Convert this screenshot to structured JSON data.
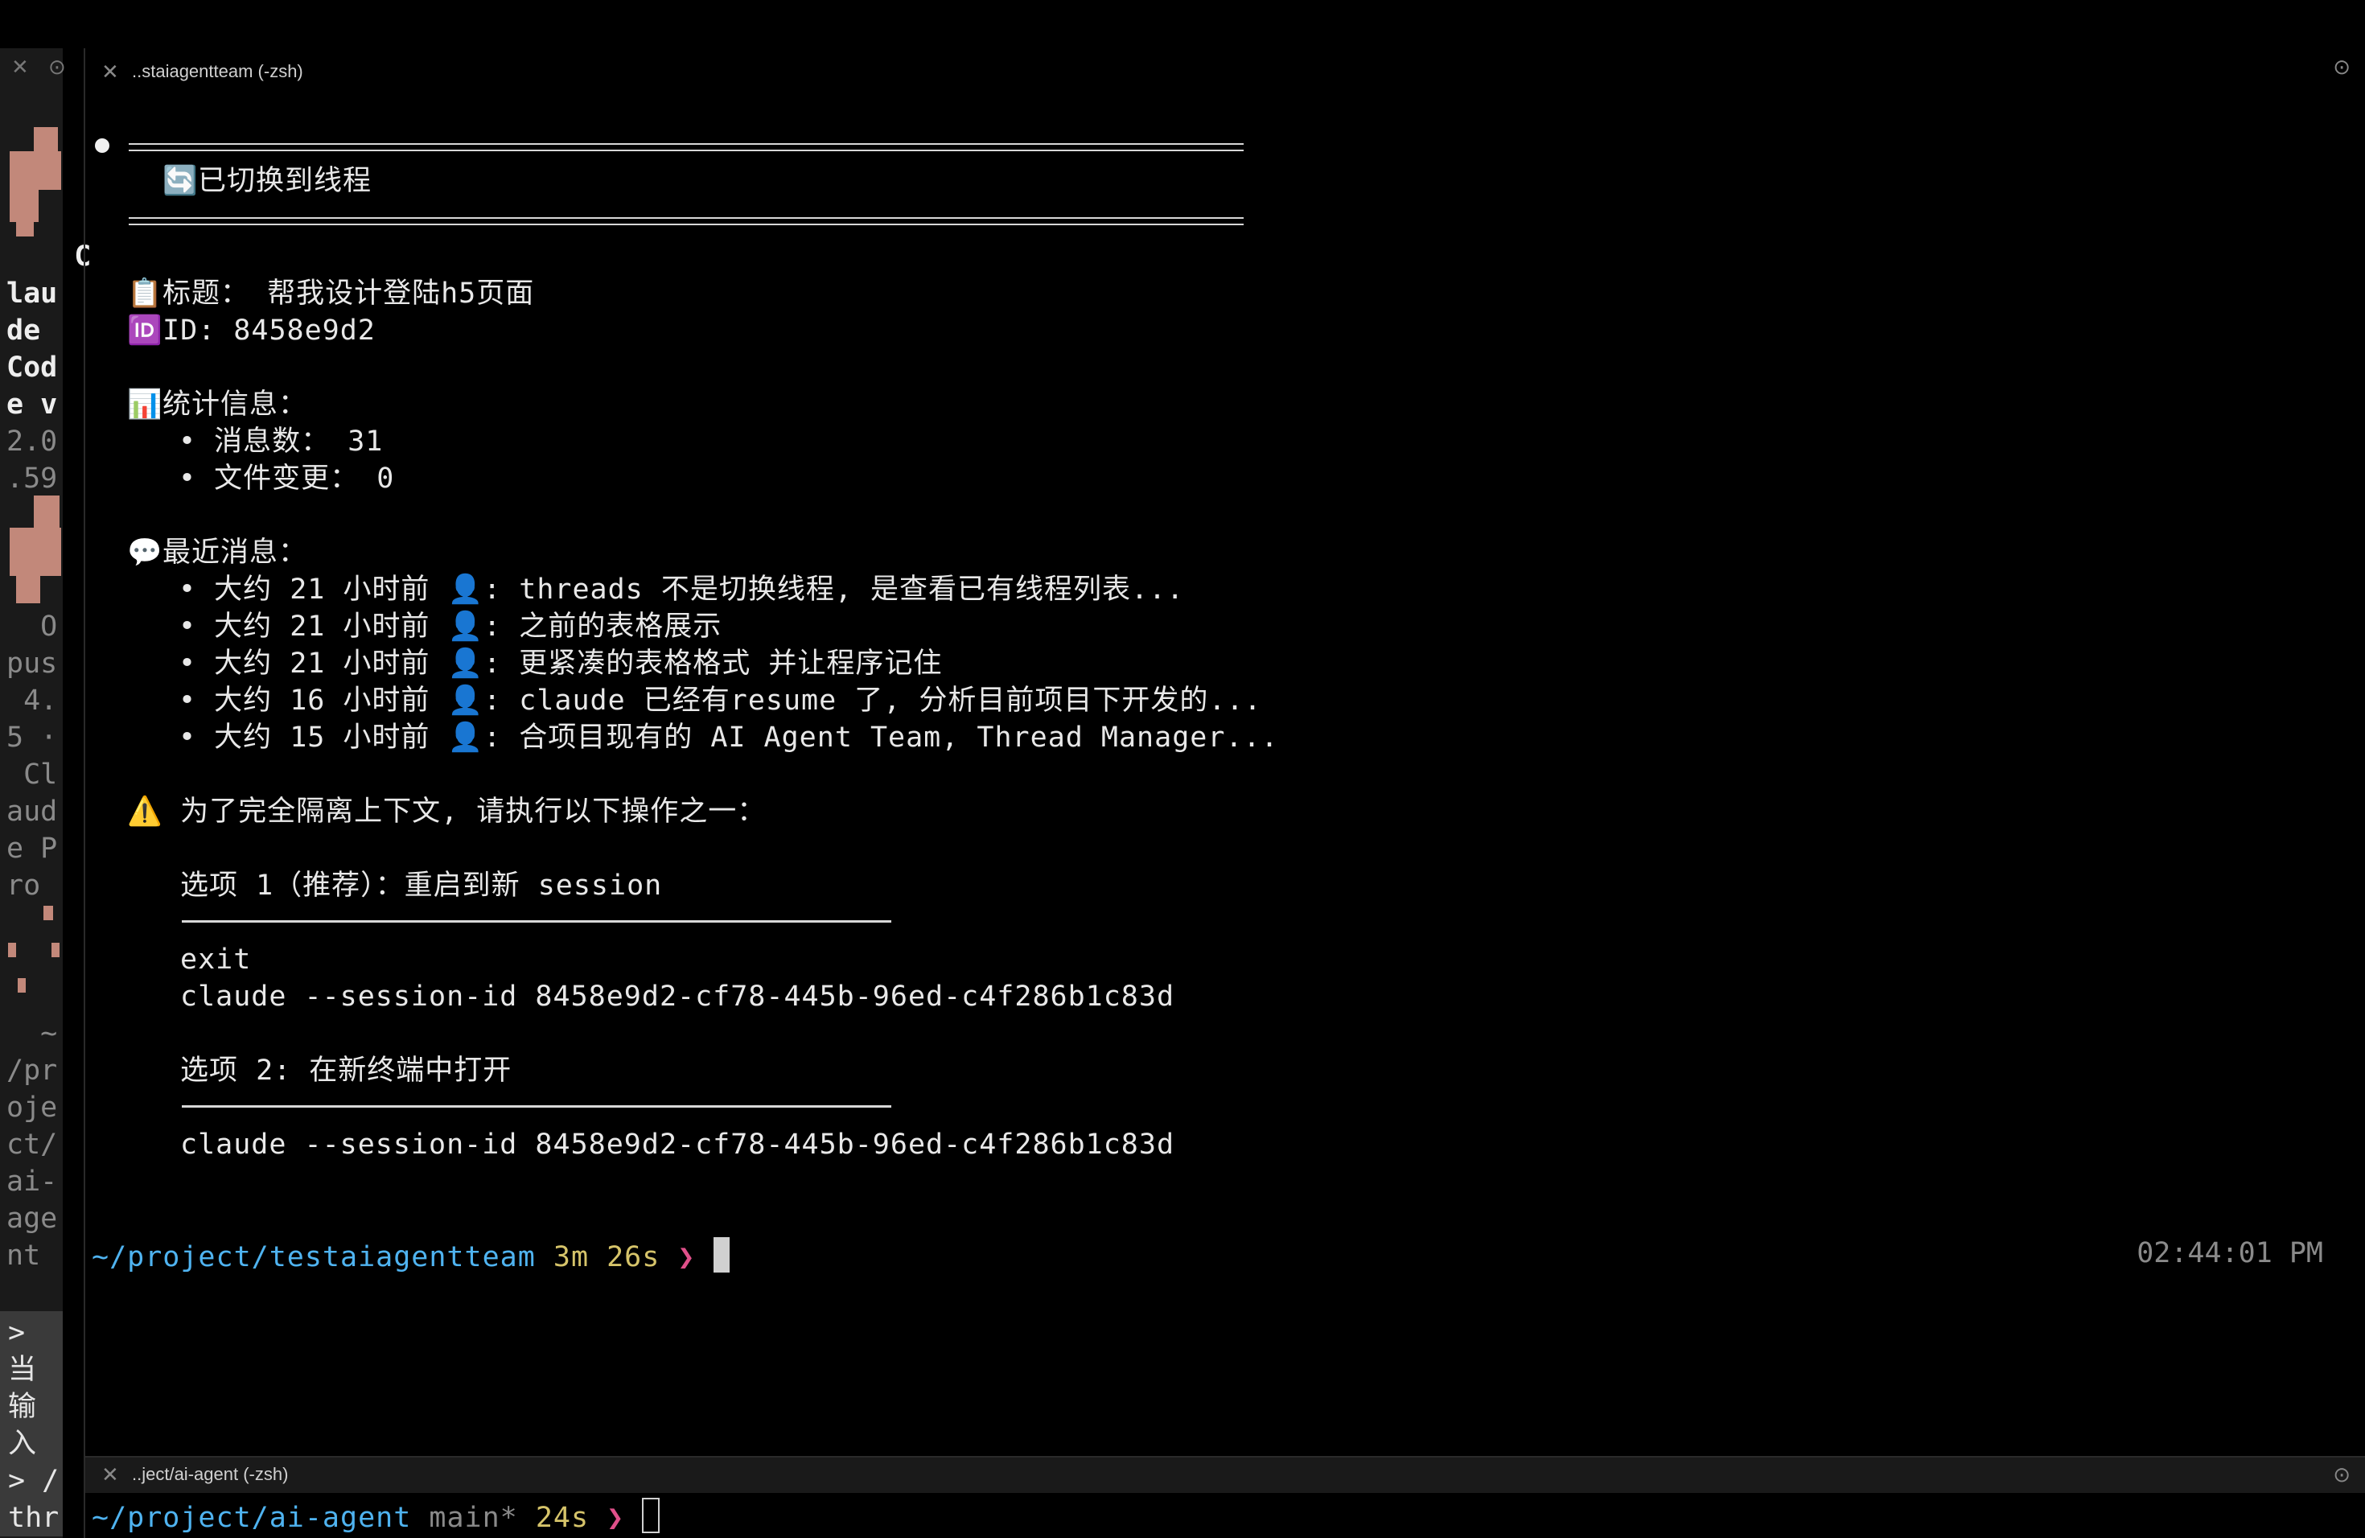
{
  "left_pane": {
    "lines": [
      {
        "t": "    C",
        "s": "bold"
      },
      {
        "t": "lau",
        "s": "bold"
      },
      {
        "t": "de",
        "s": "bold"
      },
      {
        "t": "Cod",
        "s": "bold"
      },
      {
        "t": "e v",
        "s": "bold"
      },
      {
        "t": "2.0",
        "s": "dim"
      },
      {
        "t": ".59",
        "s": "dim"
      },
      {
        "t": "",
        "s": "dim"
      },
      {
        "t": "",
        "s": "dim"
      },
      {
        "t": "",
        "s": "dim"
      },
      {
        "t": "  O",
        "s": "dim"
      },
      {
        "t": "pus",
        "s": "dim"
      },
      {
        "t": " 4.",
        "s": "dim"
      },
      {
        "t": "5 ·",
        "s": "dim"
      },
      {
        "t": " Cl",
        "s": "dim"
      },
      {
        "t": "aud",
        "s": "dim"
      },
      {
        "t": "e P",
        "s": "dim"
      },
      {
        "t": "ro",
        "s": "dim"
      },
      {
        "t": "",
        "s": "dim"
      },
      {
        "t": "",
        "s": "dim"
      },
      {
        "t": "",
        "s": "dim"
      },
      {
        "t": "  ~",
        "s": "dim"
      },
      {
        "t": "/pr",
        "s": "dim"
      },
      {
        "t": "oje",
        "s": "dim"
      },
      {
        "t": "ct/",
        "s": "dim"
      },
      {
        "t": "ai-",
        "s": "dim"
      },
      {
        "t": "age",
        "s": "dim"
      },
      {
        "t": "nt",
        "s": "dim"
      }
    ],
    "prompt_lines": [
      ">",
      "当",
      "输",
      "入",
      "> /",
      "thr"
    ]
  },
  "main_tab": {
    "title": "..staiagentteam (-zsh)"
  },
  "bottom_tab": {
    "title": "..ject/ai-agent (-zsh)"
  },
  "icons": {
    "close": "close-icon",
    "more": "more-icon",
    "switch": "switch-arrows-icon",
    "clipboard": "clipboard-icon",
    "id": "id-badge-icon",
    "chart": "bar-chart-icon",
    "speech": "speech-bubble-icon",
    "warning": "warning-icon",
    "user": "user-silhouette-icon"
  },
  "output": {
    "header": "已切换到线程",
    "title_label": "标题：",
    "title_value": "帮我设计登陆h5页面",
    "id_label": "ID:",
    "id_value": "8458e9d2",
    "stats_label": "统计信息：",
    "stats": [
      "• 消息数： 31",
      "• 文件变更： 0"
    ],
    "recent_label": "最近消息：",
    "recent": [
      {
        "time": "• 大约 21 小时前",
        "msg": ": threads 不是切换线程, 是查看已有线程列表..."
      },
      {
        "time": "• 大约 21 小时前",
        "msg": ": 之前的表格展示"
      },
      {
        "time": "• 大约 21 小时前",
        "msg": ": 更紧凑的表格格式 并让程序记住"
      },
      {
        "time": "• 大约 16 小时前",
        "msg": ": claude 已经有resume 了, 分析目前项目下开发的..."
      },
      {
        "time": "• 大约 15 小时前",
        "msg": ": 合项目现有的 AI Agent Team, Thread Manager..."
      }
    ],
    "warning": "为了完全隔离上下文, 请执行以下操作之一：",
    "option1_title": "选项 1（推荐）：重启到新 session",
    "option1_cmds": [
      "exit",
      "claude --session-id 8458e9d2-cf78-445b-96ed-c4f286b1c83d"
    ],
    "option2_title": "选项 2: 在新终端中打开",
    "option2_cmds": [
      "claude --session-id 8458e9d2-cf78-445b-96ed-c4f286b1c83d"
    ]
  },
  "prompt_main": {
    "path": "~/project/testaiagentteam",
    "duration": "3m 26s",
    "arrow": "❯",
    "clock": "02:44:01 PM"
  },
  "prompt_bottom": {
    "path": "~/project/ai-agent",
    "git": "main*",
    "duration": "24s",
    "arrow": "❯"
  }
}
